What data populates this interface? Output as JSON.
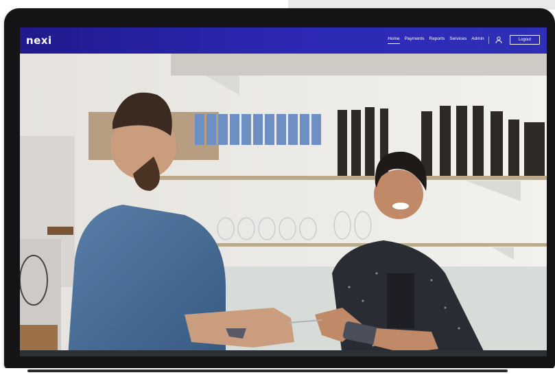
{
  "app": {
    "logo_text": "nexi",
    "brand_color": "#2a26a8"
  },
  "nav": {
    "items": [
      {
        "label": "Home",
        "active": true
      },
      {
        "label": "Payments"
      },
      {
        "label": "Reports"
      },
      {
        "label": "Services"
      },
      {
        "label": "Admin"
      }
    ],
    "user_icon": "user-icon",
    "logout_label": "Logout"
  },
  "hero": {
    "image_icon": "cafe-payment-photo"
  }
}
